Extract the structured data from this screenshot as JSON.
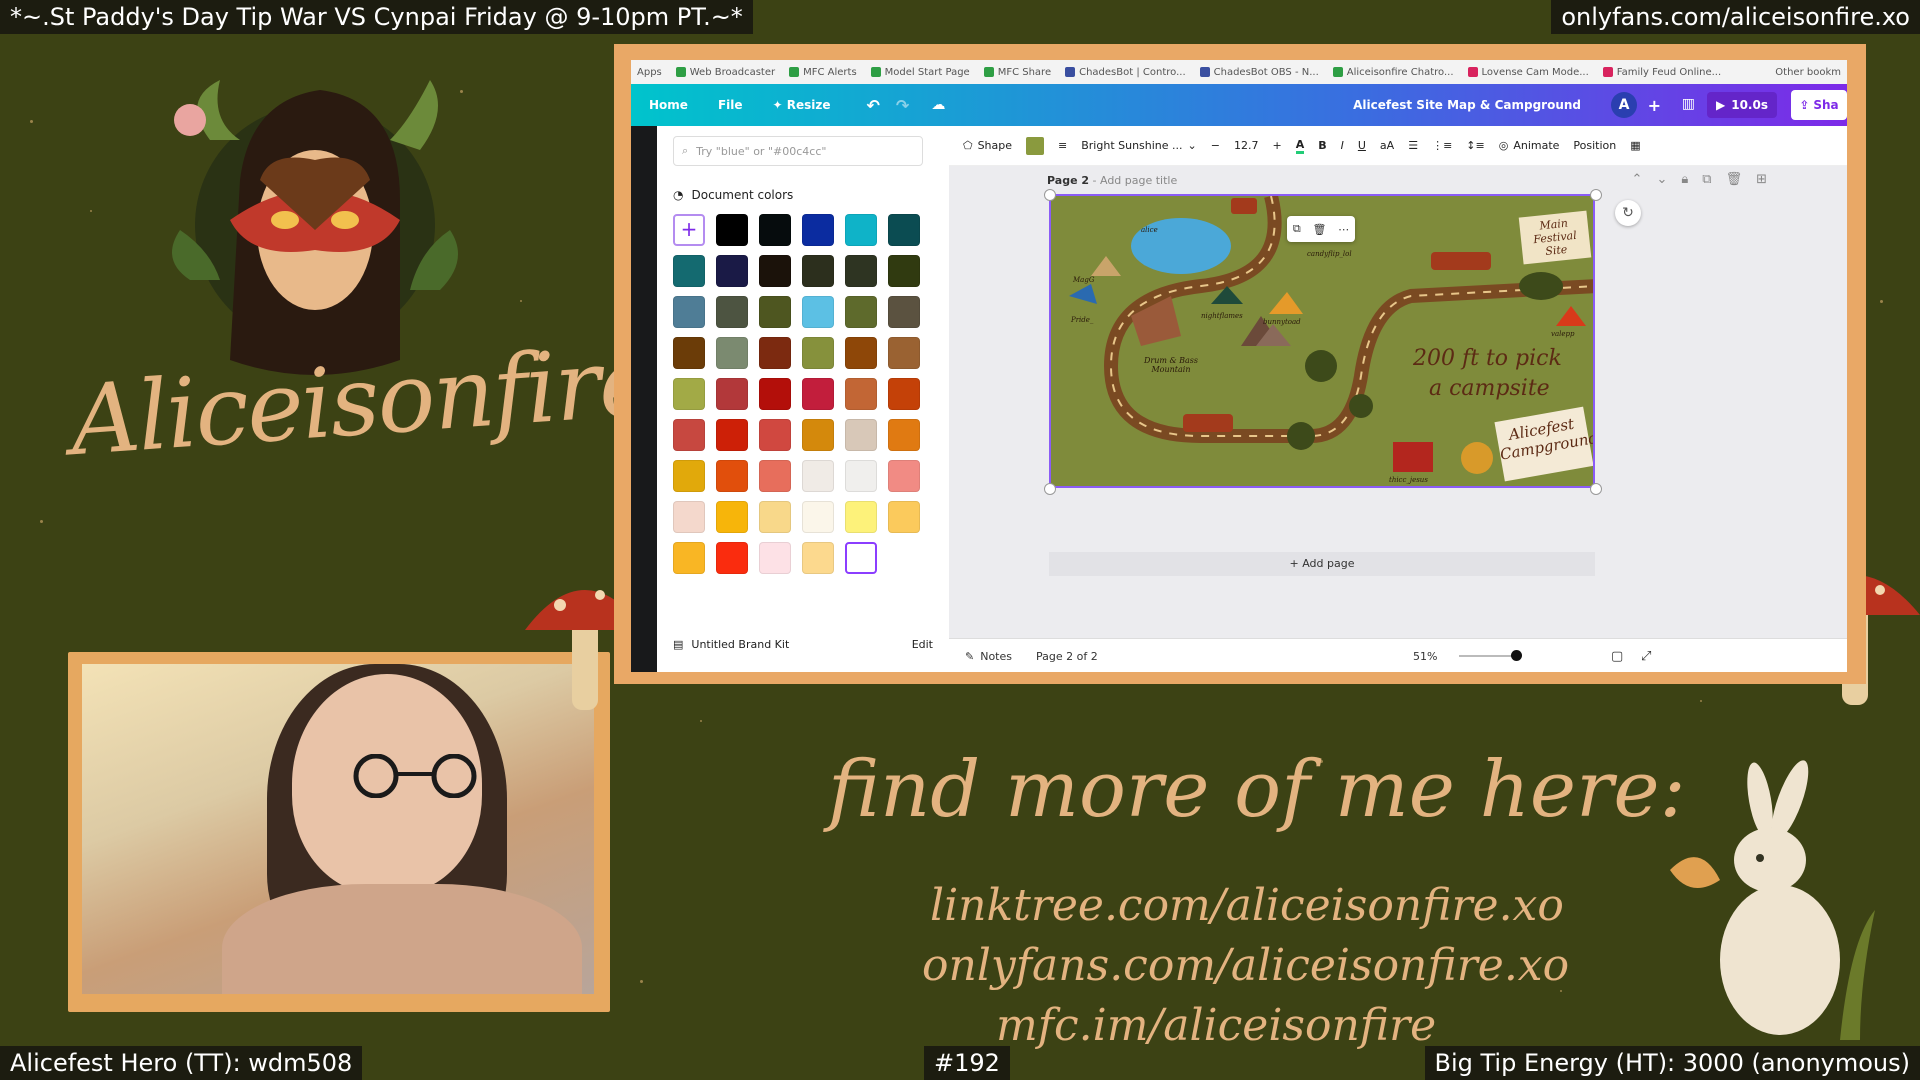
{
  "overlay": {
    "top_left_banner": "*~.St Paddy's Day Tip War VS Cynpai Friday @ 9-10pm PT.~*",
    "top_right_banner": "onlyfans.com/aliceisonfire.xo",
    "bottom_left_banner": "Alicefest Hero (TT): wdm508",
    "bottom_center_banner": "#192",
    "bottom_right_banner": "Big Tip Energy (HT): 3000 (anonymous)",
    "brand_name": "Aliceisonfire",
    "find_more": "find more of me here:",
    "links": [
      "linktree.com/aliceisonfire.xo",
      "onlyfans.com/aliceisonfire.xo",
      "mfc.im/aliceisonfire"
    ],
    "colors": {
      "background": "#3c4214",
      "accent": "#e3b380",
      "frame": "#e9a866"
    }
  },
  "browser": {
    "bookmarks": [
      "Apps",
      "Web Broadcaster",
      "MFC Alerts",
      "Model Start Page",
      "MFC Share",
      "ChadesBot | Contro...",
      "ChadesBot OBS - N...",
      "Aliceisonfire Chatro...",
      "Lovense Cam Mode...",
      "Family Feud Online..."
    ],
    "other_bookmarks": "Other bookm"
  },
  "canva": {
    "topbar": {
      "home": "Home",
      "file": "File",
      "resize": "Resize",
      "doc_title": "Alicefest Site Map & Campground",
      "avatar_initial": "A",
      "present_label": "10.0s",
      "share_label": "Sha"
    },
    "color_panel": {
      "search_placeholder": "Try \"blue\" or \"#00c4cc\"",
      "document_colors_title": "Document colors",
      "swatches": [
        "add",
        "#000000",
        "#060c0d",
        "#0b2ca0",
        "#0fb3c8",
        "#0b4c52",
        "#146a70",
        "#1a1a46",
        "#1b120a",
        "#2c2f1d",
        "#2e3422",
        "#303a10",
        "#4f7d96",
        "#4d5441",
        "#4e5620",
        "#5cc0e4",
        "#5e6a2c",
        "#5b5240",
        "#6b3c08",
        "#7b8a70",
        "#7c2a10",
        "#86913c",
        "#8e4708",
        "#9a6232",
        "#a2aa46",
        "#b2383a",
        "#b30f0a",
        "#c21e3c",
        "#c26635",
        "#c44108",
        "#c74840",
        "#cd2007",
        "#d04840",
        "#d4890c",
        "#d8c8b8",
        "#e07a12",
        "#e1a90b",
        "#e14f0c",
        "#e76e5c",
        "#f0ebe6",
        "#f0efed",
        "#f18b84",
        "#f4d8cc",
        "#f7b50a",
        "#f8d88a",
        "#fbf6ea",
        "#fdf27a",
        "#fbca5c",
        "#f9b624",
        "#fa2c0e",
        "#fde1e6",
        "#fcd98e",
        "selected"
      ],
      "brand_kit_label": "Untitled Brand Kit",
      "brand_kit_edit": "Edit"
    },
    "toolbar": {
      "shape_label": "Shape",
      "font_name": "Bright Sunshine ...",
      "font_size": "12.7",
      "animate_label": "Animate",
      "position_label": "Position"
    },
    "page": {
      "label": "Page 2",
      "title_placeholder": "- Add page title",
      "add_page": "+ Add page"
    },
    "map": {
      "sign_main": "Main Festival Site",
      "big_text_line1": "200 ft to pick",
      "big_text_line2": "a campsite",
      "campground_line1": "Alicefest",
      "campground_line2": "Campground",
      "mountain_label": "Drum & Bass Mountain",
      "labels": [
        "alice",
        "candyflip_lol",
        "MagG",
        "Pride_",
        "nightflames",
        "bunnytoad",
        "valepp",
        "thicc_jesus"
      ]
    },
    "statusbar": {
      "notes": "Notes",
      "page_count": "Page 2 of 2",
      "zoom": "51%",
      "zoom_level": 0.51
    }
  }
}
